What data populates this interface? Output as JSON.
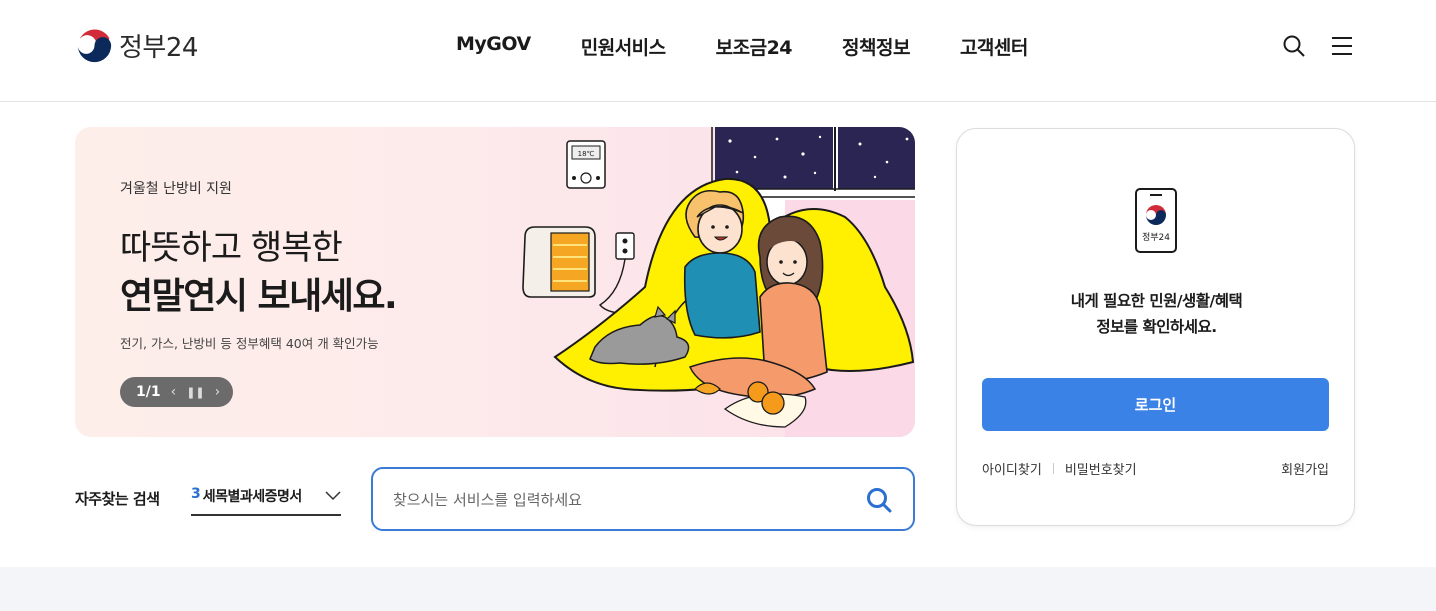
{
  "header": {
    "logo_text": "정부24",
    "nav": [
      "MyGOV",
      "민원서비스",
      "보조금24",
      "정책정보",
      "고객센터"
    ],
    "search_icon": "search-icon",
    "menu_icon": "hamburger-menu-icon"
  },
  "banner": {
    "eyebrow": "겨울철 난방비 지원",
    "title_line1": "따뜻하고 행복한",
    "title_line2": "연말연시 보내세요.",
    "description": "전기, 가스, 난방비 등 정부혜택 40여 개 확인가능",
    "pagination": "1/1",
    "thermostat_text": "18℃"
  },
  "search": {
    "label": "자주찾는 검색",
    "keyword_rank": "3",
    "keyword_text": "세목별과세증명서",
    "placeholder": "찾으시는 서비스를 입력하세요"
  },
  "login": {
    "app_label": "정부24",
    "message_line1": "내게 필요한 민원/생활/혜택",
    "message_line2": "정보를 확인하세요.",
    "button": "로그인",
    "find_id": "아이디찾기",
    "find_password": "비밀번호찾기",
    "signup": "회원가입"
  },
  "colors": {
    "accent": "#3b82e6",
    "search_border": "#3a7bd5",
    "keyword_rank": "#2b6fd1"
  }
}
